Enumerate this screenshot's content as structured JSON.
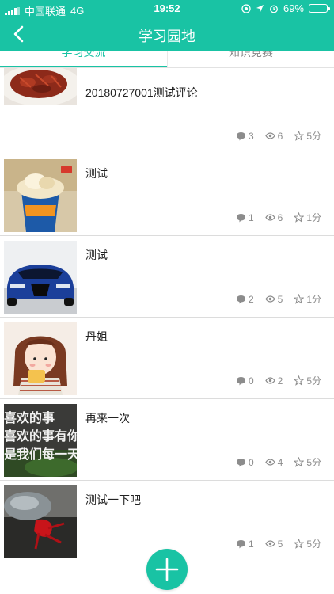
{
  "status_bar": {
    "carrier": "中国联通",
    "network": "4G",
    "time": "19:52",
    "battery": "69%",
    "battery_level": 0.69
  },
  "nav": {
    "title": "学习园地",
    "back_icon": "chevron-left-icon"
  },
  "tabs": [
    {
      "label": "学习交流",
      "active": true
    },
    {
      "label": "知识竞赛",
      "active": false
    }
  ],
  "posts": [
    {
      "title": "20180727001测试评论",
      "comments": "3",
      "views": "6",
      "score": "5分",
      "thumb": "crawfish-dish"
    },
    {
      "title": "测试",
      "comments": "1",
      "views": "6",
      "score": "1分",
      "thumb": "ice-cream-cup"
    },
    {
      "title": "测试",
      "comments": "2",
      "views": "5",
      "score": "1分",
      "thumb": "blue-car"
    },
    {
      "title": "丹姐",
      "comments": "0",
      "views": "2",
      "score": "5分",
      "thumb": "cartoon-girl"
    },
    {
      "title": "再来一次",
      "comments": "0",
      "views": "4",
      "score": "5分",
      "thumb": "text-image",
      "thumb_lines": [
        "喜欢的事",
        "喜欢的事有你",
        "是我们每一天"
      ]
    },
    {
      "title": "测试一下吧",
      "comments": "1",
      "views": "5",
      "score": "5分",
      "thumb": "dark-photo"
    }
  ],
  "fab": {
    "icon": "plus-icon"
  },
  "colors": {
    "accent": "#19c3a4"
  }
}
